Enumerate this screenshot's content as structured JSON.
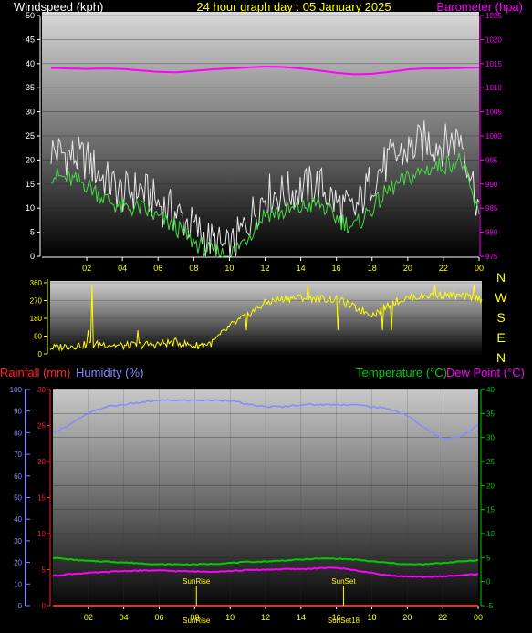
{
  "header": {
    "title": "24 hour graph day : 05 January 2025",
    "wind_label": "Windspeed (kph)",
    "baro_label": "Barometer (hpa)"
  },
  "middle": {
    "labels": [
      "Rainfall (mm)",
      "Humidity (%)",
      "Temperature (°C)",
      "Dew Point (°C)"
    ]
  },
  "colors": {
    "title": "#ffff00",
    "wind_axis": "#ffffff",
    "baro": "#ff00ff",
    "wind_gust": "#e8e8e8",
    "wind_avg": "#44dd44",
    "direction": "#ffff00",
    "rain": "#ff2222",
    "humidity": "#8888ff",
    "temperature": "#00cc00",
    "dewpoint": "#ff00ff",
    "x_ticks": "#ffff00",
    "sun": "#ffff00"
  },
  "chart_data": [
    {
      "type": "line",
      "name": "wind-barometer",
      "x_tick_labels": [
        "02",
        "04",
        "06",
        "08",
        "10",
        "12",
        "14",
        "16",
        "18",
        "20",
        "22",
        "00"
      ],
      "y_left": {
        "ticks": [
          0,
          5,
          10,
          15,
          20,
          25,
          30,
          35,
          40,
          45,
          50
        ],
        "range": [
          0,
          50
        ]
      },
      "y_right": {
        "ticks": [
          975,
          980,
          985,
          990,
          995,
          1000,
          1005,
          1010,
          1015,
          1020,
          1025
        ],
        "range": [
          975,
          1025
        ]
      },
      "barometer": [
        1014.1,
        1014.0,
        1013.9,
        1014.0,
        1013.9,
        1013.6,
        1013.3,
        1013.2,
        1013.5,
        1013.8,
        1014.0,
        1014.2,
        1014.4,
        1014.3,
        1014.0,
        1013.6,
        1013.1,
        1012.8,
        1012.9,
        1013.3,
        1013.8,
        1014.0,
        1014.0,
        1014.1,
        1014.2
      ],
      "gust": [
        22,
        21,
        20,
        16,
        13,
        14,
        11,
        9,
        6,
        3,
        1,
        7,
        13,
        13,
        14,
        15,
        11,
        9,
        16,
        20,
        22,
        24,
        23,
        25,
        10
      ],
      "average": [
        17,
        16,
        15,
        12,
        10,
        10,
        8,
        6,
        3,
        1,
        0,
        4,
        9,
        9,
        10,
        11,
        8,
        6,
        10,
        14,
        16,
        18,
        19,
        20,
        8
      ]
    },
    {
      "type": "scatter",
      "name": "wind-direction",
      "x_tick_labels": [],
      "y_left": {
        "ticks": [
          0,
          90,
          180,
          270,
          360
        ],
        "range": [
          0,
          360
        ]
      },
      "y_right_labels": [
        "N",
        "W",
        "S",
        "E",
        "N"
      ],
      "direction": [
        30,
        40,
        45,
        50,
        40,
        45,
        50,
        60,
        40,
        55,
        140,
        200,
        260,
        280,
        285,
        280,
        275,
        230,
        200,
        260,
        285,
        295,
        300,
        290,
        280
      ]
    },
    {
      "type": "line",
      "name": "humidity-temperature",
      "x_tick_labels": [
        "02",
        "04",
        "06",
        "08",
        "10",
        "12",
        "14",
        "16",
        "18",
        "20",
        "22",
        "00"
      ],
      "y_left_outer": {
        "ticks": [
          0,
          10,
          20,
          30,
          40,
          50,
          60,
          70,
          80,
          90,
          100
        ],
        "range": [
          0,
          100
        ]
      },
      "y_left_inner": {
        "ticks": [
          0,
          5,
          10,
          15,
          20,
          25,
          30
        ],
        "range": [
          0,
          30
        ]
      },
      "y_right": {
        "ticks": [
          -5,
          0,
          5,
          10,
          15,
          20,
          25,
          30,
          35,
          40
        ],
        "range": [
          -5,
          40
        ]
      },
      "humidity": [
        80,
        84,
        89,
        92,
        93,
        94,
        95,
        95,
        95,
        95,
        95,
        93,
        92,
        92,
        93,
        93,
        93,
        93,
        92,
        91,
        88,
        82,
        77,
        78,
        84
      ],
      "temperature": [
        5,
        4.6,
        4.3,
        4.2,
        4.0,
        3.8,
        3.6,
        3.6,
        3.6,
        3.7,
        3.9,
        4.1,
        4.2,
        4.4,
        4.6,
        4.8,
        4.8,
        4.6,
        4.2,
        3.9,
        3.6,
        3.6,
        3.9,
        4.2,
        4.5
      ],
      "dewpoint": [
        1.2,
        1.6,
        1.8,
        2.0,
        2.2,
        2.3,
        2.3,
        2.2,
        2.1,
        2.1,
        2.2,
        2.4,
        2.5,
        2.6,
        2.6,
        2.8,
        2.9,
        2.4,
        1.8,
        1.3,
        1.0,
        1.0,
        1.1,
        1.3,
        1.6
      ],
      "rainfall": [
        0,
        0,
        0,
        0,
        0,
        0,
        0,
        0,
        0,
        0,
        0,
        0,
        0,
        0,
        0,
        0,
        0,
        0,
        0,
        0,
        0,
        0,
        0,
        0,
        0
      ],
      "sun_events": {
        "sunrise_label": "SunRise",
        "sunset_label": "SunSet",
        "rise_bottom": "SunRise",
        "set_bottom": "SunSet18",
        "rise_hour": 8.1,
        "set_hour": 16.4
      }
    }
  ]
}
